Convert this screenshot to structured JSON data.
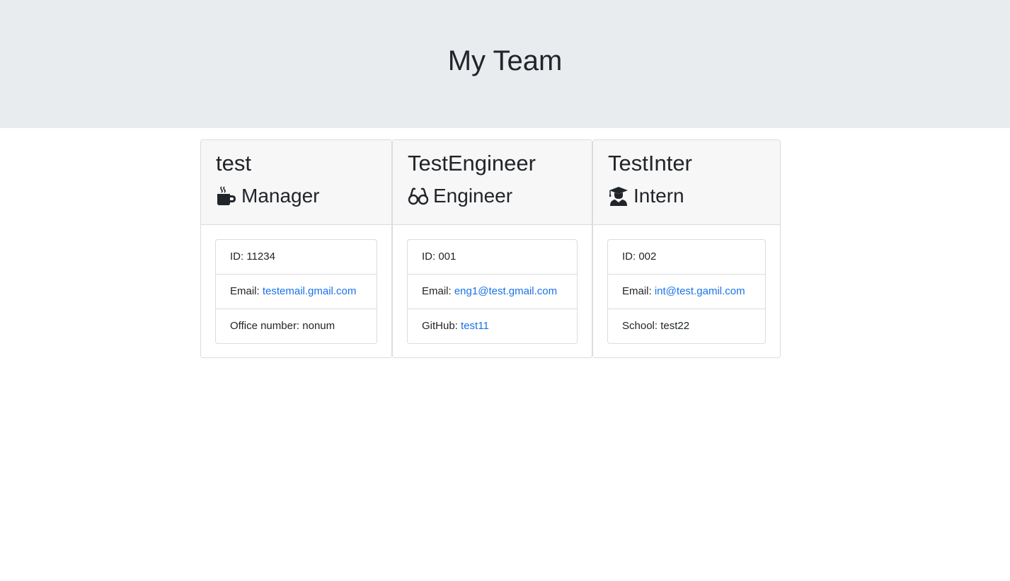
{
  "header": {
    "title": "My Team"
  },
  "cards": [
    {
      "name": "test",
      "role": "Manager",
      "icon": "mug-hot-icon",
      "id_label": "ID: ",
      "id_value": "11234",
      "email_label": "Email: ",
      "email_value": "testemail.gmail.com",
      "extra_label": "Office number: ",
      "extra_value": "nonum"
    },
    {
      "name": "TestEngineer",
      "role": "Engineer",
      "icon": "glasses-icon",
      "id_label": "ID: ",
      "id_value": "001",
      "email_label": "Email: ",
      "email_value": "eng1@test.gmail.com",
      "extra_label": "GitHub: ",
      "extra_value": "test11"
    },
    {
      "name": "TestInter",
      "role": "Intern",
      "icon": "user-graduate-icon",
      "id_label": "ID: ",
      "id_value": "002",
      "email_label": "Email: ",
      "email_value": "int@test.gamil.com",
      "extra_label": "School: ",
      "extra_value": "test22"
    }
  ],
  "colors": {
    "header_bg": "#e9ecef",
    "card_header_bg": "#f7f7f7",
    "link": "#1a73e8",
    "text": "#212529"
  }
}
